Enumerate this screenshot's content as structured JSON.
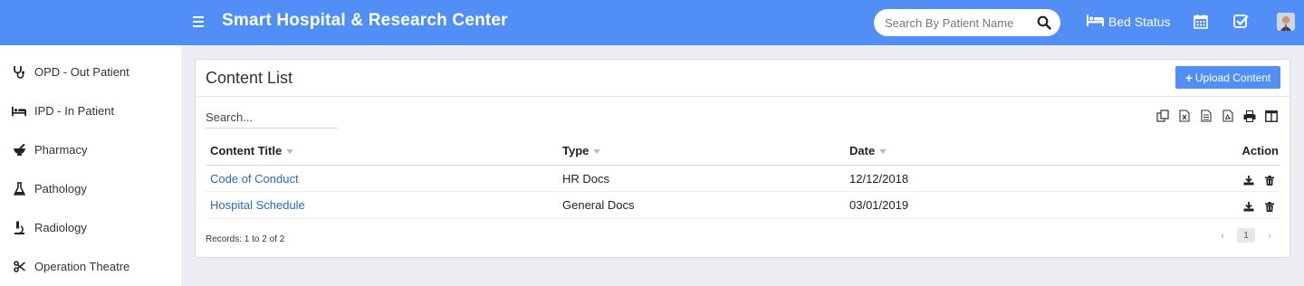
{
  "header": {
    "title": "Smart Hospital & Research Center",
    "search_placeholder": "Search By Patient Name",
    "bed_status_label": "Bed Status",
    "accent_color": "#518ff6"
  },
  "sidebar": {
    "items": [
      {
        "label": "OPD - Out Patient",
        "icon": "stethoscope-icon"
      },
      {
        "label": "IPD - In Patient",
        "icon": "bed-icon"
      },
      {
        "label": "Pharmacy",
        "icon": "mortar-pestle-icon"
      },
      {
        "label": "Pathology",
        "icon": "flask-icon"
      },
      {
        "label": "Radiology",
        "icon": "microscope-icon"
      },
      {
        "label": "Operation Theatre",
        "icon": "scissors-icon"
      }
    ]
  },
  "content": {
    "title": "Content List",
    "upload_label": "Upload Content",
    "search_placeholder": "Search...",
    "export_icons": [
      "copy-icon",
      "excel-icon",
      "csv-icon",
      "pdf-icon",
      "print-icon",
      "columns-icon"
    ],
    "columns": {
      "title": "Content Title",
      "type": "Type",
      "date": "Date",
      "action": "Action"
    },
    "rows": [
      {
        "title": "Code of Conduct",
        "type": "HR Docs",
        "date": "12/12/2018"
      },
      {
        "title": "Hospital Schedule",
        "type": "General Docs",
        "date": "03/01/2019"
      }
    ],
    "records_text": "Records: 1 to 2 of 2",
    "pagination": {
      "prev": "‹",
      "page": "1",
      "next": "›"
    }
  }
}
